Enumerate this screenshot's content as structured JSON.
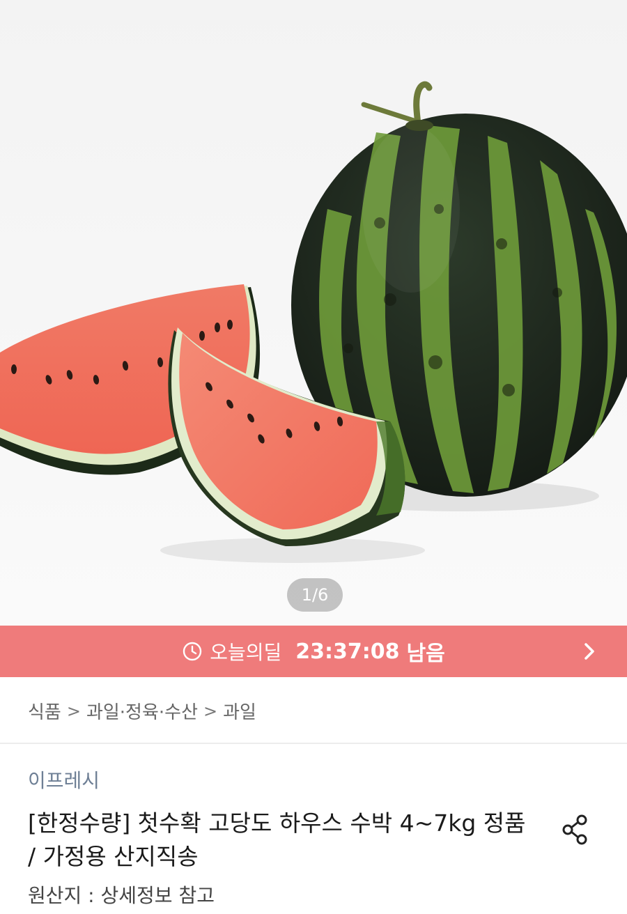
{
  "image_counter": "1/6",
  "deal": {
    "label": "오늘의딜",
    "time_left": "23:37:08",
    "suffix": "남음"
  },
  "breadcrumb": [
    "식품",
    "과일·정육·수산",
    "과일"
  ],
  "product": {
    "brand": "이프레시",
    "title": "[한정수량] 첫수확 고당도 하우스 수박 4~7kg 정품 / 가정용 산지직송",
    "origin": "원산지 : 상세정보 참고"
  },
  "colors": {
    "deal_bar": "#ef7b7b",
    "brand_text": "#6e7f95"
  },
  "icons": [
    "clock-icon",
    "chevron-right-icon",
    "share-icon"
  ]
}
